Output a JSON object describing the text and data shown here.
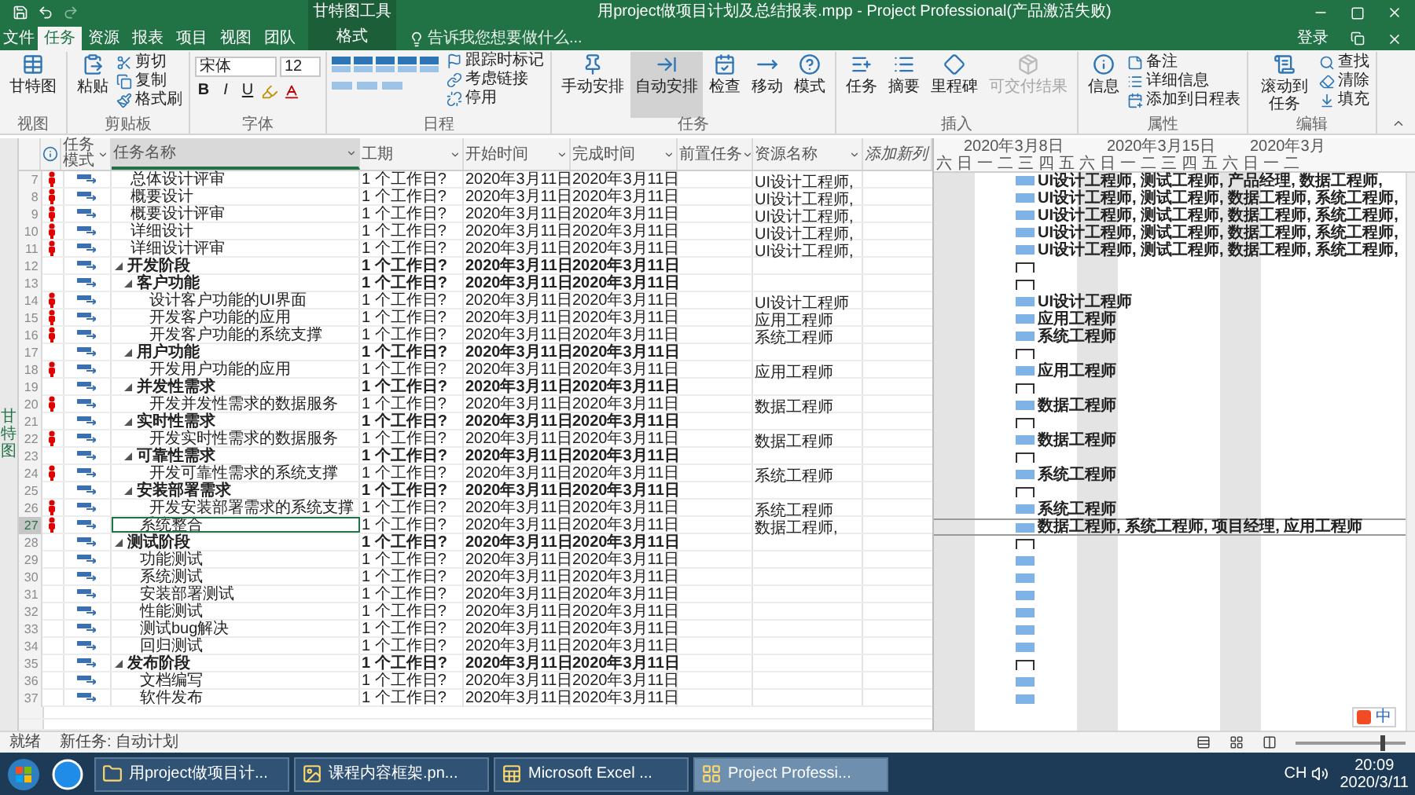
{
  "window": {
    "title": "用project做项目计划及总结报表.mpp - Project Professional(产品激活失败)",
    "context_group": "甘特图工具",
    "sign_in": "登录"
  },
  "menu_tabs": [
    {
      "label": "文件",
      "selected": false
    },
    {
      "label": "任务",
      "selected": true
    },
    {
      "label": "资源",
      "selected": false
    },
    {
      "label": "报表",
      "selected": false
    },
    {
      "label": "项目",
      "selected": false
    },
    {
      "label": "视图",
      "selected": false
    },
    {
      "label": "团队",
      "selected": false
    },
    {
      "label": "格式",
      "selected": false
    }
  ],
  "tell_me": {
    "placeholder": "告诉我您想要做什么..."
  },
  "ribbon": {
    "groups": [
      {
        "kind": "view",
        "label": "视图",
        "items": [
          {
            "kind": "large",
            "label": "甘特图"
          }
        ]
      },
      {
        "kind": "clipboard",
        "label": "剪贴板",
        "items": [
          {
            "kind": "large",
            "label": "粘贴"
          },
          {
            "kind": "small",
            "label": "剪切"
          },
          {
            "kind": "small",
            "label": "复制"
          },
          {
            "kind": "small",
            "label": "格式刷"
          }
        ]
      },
      {
        "kind": "font",
        "label": "字体",
        "font_name": "宋体",
        "font_size": "12",
        "styles": [
          "B",
          "I",
          "U"
        ]
      },
      {
        "kind": "schedule",
        "label": "日程",
        "items": [
          {
            "kind": "small",
            "label": "跟踪时标记"
          },
          {
            "kind": "small",
            "label": "考虑链接"
          },
          {
            "kind": "small",
            "label": "停用"
          }
        ]
      },
      {
        "kind": "tasks",
        "label": "任务",
        "items": [
          {
            "kind": "large",
            "label": "手动安排",
            "selected": false
          },
          {
            "kind": "large",
            "label": "自动安排",
            "selected": true
          },
          {
            "kind": "large",
            "label": "检查"
          },
          {
            "kind": "large",
            "label": "移动"
          },
          {
            "kind": "large",
            "label": "模式"
          }
        ]
      },
      {
        "kind": "insert",
        "label": "插入",
        "items": [
          {
            "kind": "large",
            "label": "任务"
          },
          {
            "kind": "large",
            "label": "摘要"
          },
          {
            "kind": "large",
            "label": "里程碑"
          },
          {
            "kind": "large",
            "label": "可交付结果",
            "disabled": true
          }
        ]
      },
      {
        "kind": "properties",
        "label": "属性",
        "items": [
          {
            "kind": "large",
            "label": "信息"
          },
          {
            "kind": "small",
            "label": "备注"
          },
          {
            "kind": "small",
            "label": "详细信息"
          },
          {
            "kind": "small",
            "label": "添加到日程表"
          }
        ]
      },
      {
        "kind": "editing",
        "label": "编辑",
        "items": [
          {
            "kind": "large",
            "label": "滚动到任务"
          },
          {
            "kind": "small",
            "label": "查找"
          },
          {
            "kind": "small",
            "label": "清除"
          },
          {
            "kind": "small",
            "label": "填充"
          }
        ]
      }
    ]
  },
  "side_label": "甘特图",
  "table": {
    "columns": [
      "任务模式",
      "任务名称",
      "工期",
      "开始时间",
      "完成时间",
      "前置任务",
      "资源名称",
      "添加新列"
    ],
    "tasks": [
      {
        "id": "7",
        "kind": "task",
        "overallocated": true,
        "selected": false,
        "name": "总体设计评审",
        "duration": "1 个工作日?",
        "start": "2020年3月11日",
        "finish": "2020年3月11日",
        "resources": "UI设计工程师,",
        "bar_label": "UI设计工程师, 测试工程师, 产品经理, 数据工程师,"
      },
      {
        "id": "8",
        "kind": "task",
        "overallocated": true,
        "selected": false,
        "name": "概要设计",
        "duration": "1 个工作日?",
        "start": "2020年3月11日",
        "finish": "2020年3月11日",
        "resources": "UI设计工程师,",
        "bar_label": "UI设计工程师, 测试工程师, 数据工程师, 系统工程师,"
      },
      {
        "id": "9",
        "kind": "task",
        "overallocated": true,
        "selected": false,
        "name": "概要设计评审",
        "duration": "1 个工作日?",
        "start": "2020年3月11日",
        "finish": "2020年3月11日",
        "resources": "UI设计工程师,",
        "bar_label": "UI设计工程师, 测试工程师, 数据工程师, 系统工程师,"
      },
      {
        "id": "10",
        "kind": "task",
        "overallocated": true,
        "selected": false,
        "name": "详细设计",
        "duration": "1 个工作日?",
        "start": "2020年3月11日",
        "finish": "2020年3月11日",
        "resources": "UI设计工程师,",
        "bar_label": "UI设计工程师, 测试工程师, 数据工程师, 系统工程师,"
      },
      {
        "id": "11",
        "kind": "task",
        "overallocated": true,
        "selected": false,
        "name": "详细设计评审",
        "duration": "1 个工作日?",
        "start": "2020年3月11日",
        "finish": "2020年3月11日",
        "resources": "UI设计工程师,",
        "bar_label": "UI设计工程师, 测试工程师, 数据工程师, 系统工程师,"
      },
      {
        "id": "12",
        "kind": "summary",
        "overallocated": false,
        "selected": false,
        "name": "开发阶段",
        "duration": "1 个工作日?",
        "start": "2020年3月11日",
        "finish": "2020年3月11日",
        "children": [
          {
            "id": "13",
            "kind": "summary",
            "overallocated": false,
            "selected": false,
            "name": "客户功能",
            "duration": "1 个工作日?",
            "start": "2020年3月11日",
            "finish": "2020年3月11日",
            "children": [
              {
                "id": "14",
                "kind": "task",
                "overallocated": true,
                "selected": false,
                "name": "设计客户功能的UI界面",
                "duration": "1 个工作日?",
                "start": "2020年3月11日",
                "finish": "2020年3月11日",
                "resources": "UI设计工程师",
                "bar_label": "UI设计工程师"
              },
              {
                "id": "15",
                "kind": "task",
                "overallocated": true,
                "selected": false,
                "name": "开发客户功能的应用",
                "duration": "1 个工作日?",
                "start": "2020年3月11日",
                "finish": "2020年3月11日",
                "resources": "应用工程师",
                "bar_label": "应用工程师"
              },
              {
                "id": "16",
                "kind": "task",
                "overallocated": true,
                "selected": false,
                "name": "开发客户功能的系统支撑",
                "duration": "1 个工作日?",
                "start": "2020年3月11日",
                "finish": "2020年3月11日",
                "resources": "系统工程师",
                "bar_label": "系统工程师"
              }
            ]
          },
          {
            "id": "17",
            "kind": "summary",
            "overallocated": false,
            "selected": false,
            "name": "用户功能",
            "duration": "1 个工作日?",
            "start": "2020年3月11日",
            "finish": "2020年3月11日",
            "children": [
              {
                "id": "18",
                "kind": "task",
                "overallocated": true,
                "selected": false,
                "name": "开发用户功能的应用",
                "duration": "1 个工作日?",
                "start": "2020年3月11日",
                "finish": "2020年3月11日",
                "resources": "应用工程师",
                "bar_label": "应用工程师"
              }
            ]
          },
          {
            "id": "19",
            "kind": "summary",
            "overallocated": false,
            "selected": false,
            "name": "并发性需求",
            "duration": "1 个工作日?",
            "start": "2020年3月11日",
            "finish": "2020年3月11日",
            "children": [
              {
                "id": "20",
                "kind": "task",
                "overallocated": true,
                "selected": false,
                "name": "开发并发性需求的数据服务",
                "duration": "1 个工作日?",
                "start": "2020年3月11日",
                "finish": "2020年3月11日",
                "resources": "数据工程师",
                "bar_label": "数据工程师"
              }
            ]
          },
          {
            "id": "21",
            "kind": "summary",
            "overallocated": false,
            "selected": false,
            "name": "实时性需求",
            "duration": "1 个工作日?",
            "start": "2020年3月11日",
            "finish": "2020年3月11日",
            "children": [
              {
                "id": "22",
                "kind": "task",
                "overallocated": true,
                "selected": false,
                "name": "开发实时性需求的数据服务",
                "duration": "1 个工作日?",
                "start": "2020年3月11日",
                "finish": "2020年3月11日",
                "resources": "数据工程师",
                "bar_label": "数据工程师"
              }
            ]
          },
          {
            "id": "23",
            "kind": "summary",
            "overallocated": false,
            "selected": false,
            "name": "可靠性需求",
            "duration": "1 个工作日?",
            "start": "2020年3月11日",
            "finish": "2020年3月11日",
            "children": [
              {
                "id": "24",
                "kind": "task",
                "overallocated": true,
                "selected": false,
                "name": "开发可靠性需求的系统支撑",
                "duration": "1 个工作日?",
                "start": "2020年3月11日",
                "finish": "2020年3月11日",
                "resources": "系统工程师",
                "bar_label": "系统工程师"
              }
            ]
          },
          {
            "id": "25",
            "kind": "summary",
            "overallocated": false,
            "selected": false,
            "name": "安装部署需求",
            "duration": "1 个工作日?",
            "start": "2020年3月11日",
            "finish": "2020年3月11日",
            "children": [
              {
                "id": "26",
                "kind": "task",
                "overallocated": true,
                "selected": false,
                "name": "开发安装部署需求的系统支撑",
                "duration": "1 个工作日?",
                "start": "2020年3月11日",
                "finish": "2020年3月11日",
                "resources": "系统工程师",
                "bar_label": "系统工程师"
              }
            ]
          },
          {
            "id": "27",
            "kind": "task",
            "overallocated": true,
            "selected": true,
            "name": "系统整合",
            "duration": "1 个工作日?",
            "start": "2020年3月11日",
            "finish": "2020年3月11日",
            "resources": "数据工程师,",
            "bar_label": "数据工程师, 系统工程师, 项目经理, 应用工程师"
          }
        ]
      },
      {
        "id": "28",
        "kind": "summary",
        "overallocated": false,
        "selected": false,
        "name": "测试阶段",
        "duration": "1 个工作日?",
        "start": "2020年3月11日",
        "finish": "2020年3月11日",
        "children": [
          {
            "id": "29",
            "kind": "task",
            "overallocated": false,
            "selected": false,
            "name": "功能测试",
            "duration": "1 个工作日?",
            "start": "2020年3月11日",
            "finish": "2020年3月11日"
          },
          {
            "id": "30",
            "kind": "task",
            "overallocated": false,
            "selected": false,
            "name": "系统测试",
            "duration": "1 个工作日?",
            "start": "2020年3月11日",
            "finish": "2020年3月11日"
          },
          {
            "id": "31",
            "kind": "task",
            "overallocated": false,
            "selected": false,
            "name": "安装部署测试",
            "duration": "1 个工作日?",
            "start": "2020年3月11日",
            "finish": "2020年3月11日"
          },
          {
            "id": "32",
            "kind": "task",
            "overallocated": false,
            "selected": false,
            "name": "性能测试",
            "duration": "1 个工作日?",
            "start": "2020年3月11日",
            "finish": "2020年3月11日"
          },
          {
            "id": "33",
            "kind": "task",
            "overallocated": false,
            "selected": false,
            "name": "测试bug解决",
            "duration": "1 个工作日?",
            "start": "2020年3月11日",
            "finish": "2020年3月11日"
          },
          {
            "id": "34",
            "kind": "task",
            "overallocated": false,
            "selected": false,
            "name": "回归测试",
            "duration": "1 个工作日?",
            "start": "2020年3月11日",
            "finish": "2020年3月11日"
          }
        ]
      },
      {
        "id": "35",
        "kind": "summary",
        "overallocated": false,
        "selected": false,
        "name": "发布阶段",
        "duration": "1 个工作日?",
        "start": "2020年3月11日",
        "finish": "2020年3月11日",
        "children": [
          {
            "id": "36",
            "kind": "task",
            "overallocated": false,
            "selected": false,
            "name": "文档编写",
            "duration": "1 个工作日?",
            "start": "2020年3月11日",
            "finish": "2020年3月11日"
          },
          {
            "id": "37",
            "kind": "task",
            "overallocated": false,
            "selected": false,
            "name": "软件发布",
            "duration": "1 个工作日?",
            "start": "2020年3月11日",
            "finish": "2020年3月11日"
          }
        ]
      }
    ]
  },
  "timescale": {
    "weeks": [
      "2020年3月8日",
      "2020年3月15日",
      "2020年3月"
    ],
    "days": [
      {
        "label": "六",
        "weekend": true
      },
      {
        "label": "日",
        "weekend": true
      },
      {
        "label": "一",
        "weekend": false
      },
      {
        "label": "二",
        "weekend": false
      },
      {
        "label": "三",
        "weekend": false
      },
      {
        "label": "四",
        "weekend": false
      },
      {
        "label": "五",
        "weekend": false
      },
      {
        "label": "六",
        "weekend": true
      },
      {
        "label": "日",
        "weekend": true
      },
      {
        "label": "一",
        "weekend": false
      },
      {
        "label": "二",
        "weekend": false
      },
      {
        "label": "三",
        "weekend": false
      },
      {
        "label": "四",
        "weekend": false
      },
      {
        "label": "五",
        "weekend": false
      },
      {
        "label": "六",
        "weekend": true
      },
      {
        "label": "日",
        "weekend": true
      },
      {
        "label": "一",
        "weekend": false
      },
      {
        "label": "二",
        "weekend": false
      }
    ]
  },
  "ime_bar": {
    "mode": "中"
  },
  "status_bar": {
    "ready": "就绪",
    "new_task": "新任务: 自动计划",
    "zoom": {
      "level": 0.8
    }
  },
  "taskbar": {
    "items": [
      {
        "label": "用project做项目计...",
        "selected": false
      },
      {
        "label": "课程内容框架.pn...",
        "selected": false
      },
      {
        "label": "Microsoft Excel ...",
        "selected": false
      },
      {
        "label": "Project Professi...",
        "selected": true
      }
    ],
    "language": "CH",
    "time": "20:09",
    "date": "2020/3/11"
  }
}
